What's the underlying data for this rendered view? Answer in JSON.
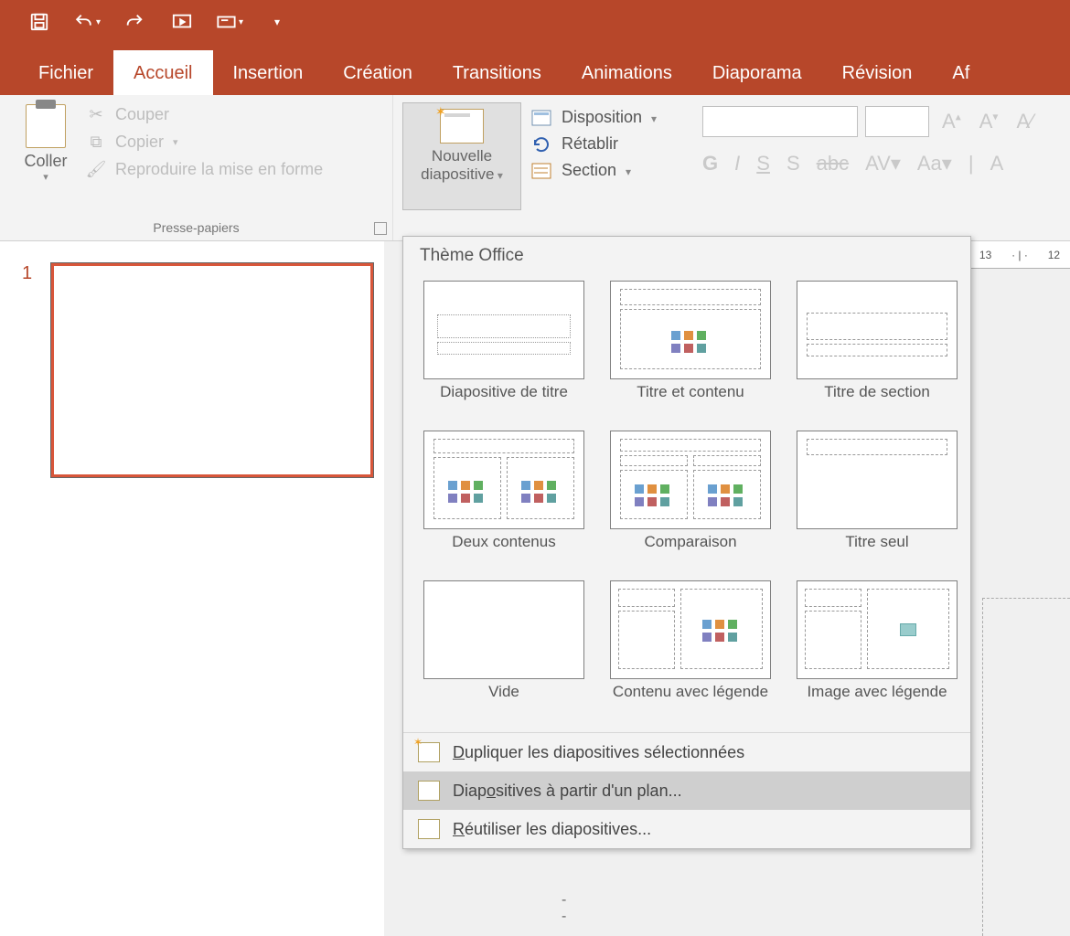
{
  "qat": {
    "tooltips": [
      "Enregistrer",
      "Annuler",
      "Rétablir",
      "Diaporama",
      "Mode",
      "Personnaliser"
    ]
  },
  "tabs": [
    "Fichier",
    "Accueil",
    "Insertion",
    "Création",
    "Transitions",
    "Animations",
    "Diaporama",
    "Révision",
    "Af"
  ],
  "active_tab_index": 1,
  "clipboard": {
    "paste": "Coller",
    "cut": "Couper",
    "copy": "Copier",
    "format_painter": "Reproduire la mise en forme",
    "group": "Presse-papiers"
  },
  "slides_group": {
    "new_slide": "Nouvelle diapositive",
    "layout": "Disposition",
    "reset": "Rétablir",
    "section": "Section"
  },
  "font_group": {
    "buttons_row2": [
      "G",
      "I",
      "S",
      "S",
      "abc",
      "AV",
      "Aa",
      "A"
    ]
  },
  "thumb": {
    "number": "1"
  },
  "ruler_ticks": [
    "13",
    "12"
  ],
  "gallery": {
    "header": "Thème Office",
    "layouts": [
      "Diapositive de titre",
      "Titre et contenu",
      "Titre de section",
      "Deux contenus",
      "Comparaison",
      "Titre seul",
      "Vide",
      "Contenu avec légende",
      "Image avec légende"
    ],
    "menu": {
      "duplicate": "Dupliquer les diapositives sélectionnées",
      "from_outline": "Diapositives à partir d'un plan...",
      "reuse": "Réutiliser les diapositives..."
    },
    "menu_selected_index": 1
  }
}
